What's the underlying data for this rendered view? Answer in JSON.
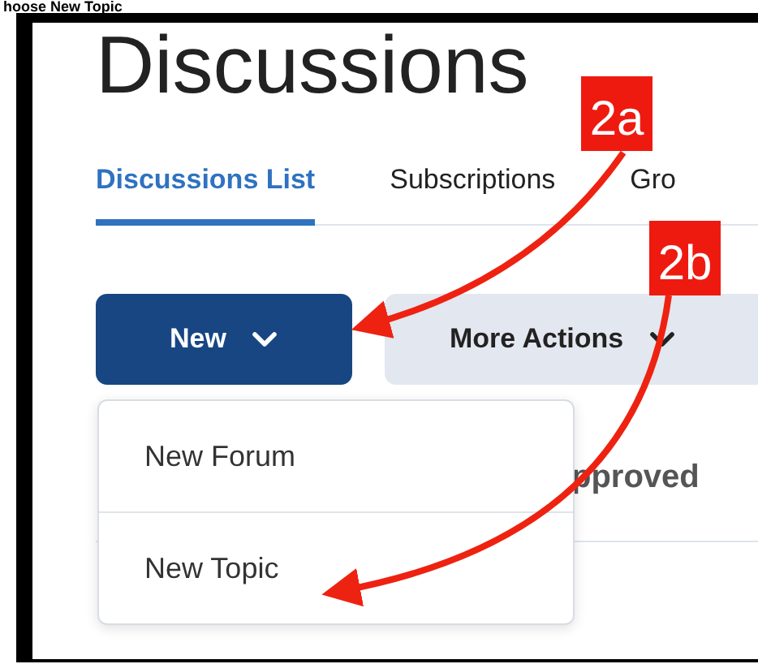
{
  "caption": "hoose New Topic",
  "page": {
    "title": "Discussions"
  },
  "tabs": [
    {
      "label": "Discussions List",
      "selected": true
    },
    {
      "label": "Subscriptions",
      "selected": false
    },
    {
      "label": "Gro",
      "selected": false
    }
  ],
  "buttons": [
    {
      "label": "New",
      "kind": "primary"
    },
    {
      "label": "More Actions",
      "kind": "secondary"
    }
  ],
  "dropdown": {
    "items": [
      {
        "label": "New Forum"
      },
      {
        "label": "New Topic"
      }
    ]
  },
  "column_heading": "pproved",
  "annotations": [
    {
      "label": "2a"
    },
    {
      "label": "2b"
    }
  ]
}
